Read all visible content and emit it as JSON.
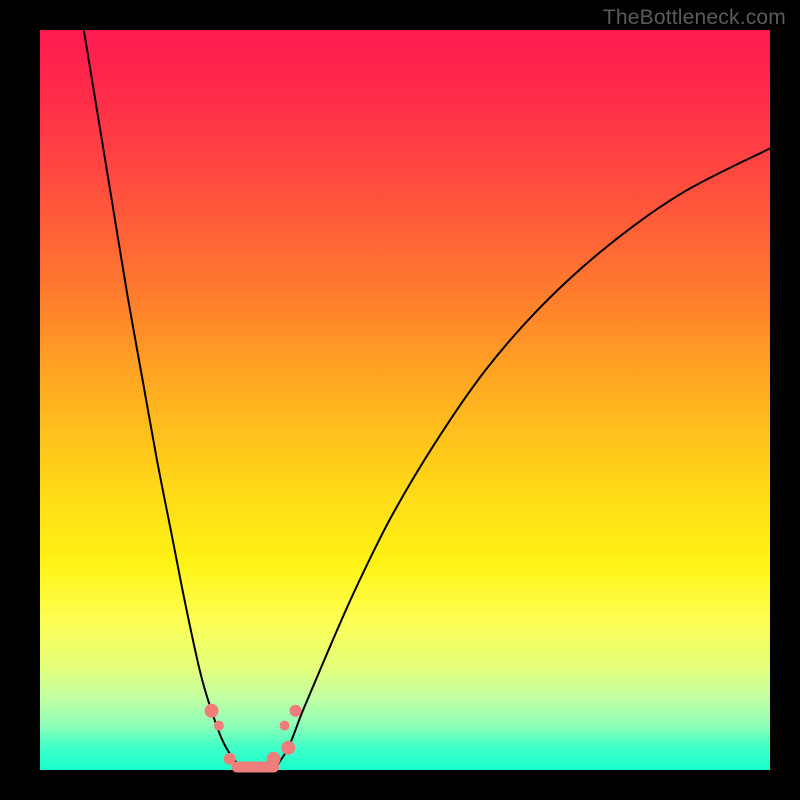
{
  "watermark": "TheBottleneck.com",
  "colors": {
    "frame": "#000000",
    "curve": "#000000",
    "marker": "#ef7d7a",
    "gradient_top": "#ff1a4f",
    "gradient_bottom": "#17ffce"
  },
  "chart_data": {
    "type": "line",
    "title": "",
    "xlabel": "",
    "ylabel": "",
    "xlim": [
      0,
      100
    ],
    "ylim": [
      0,
      100
    ],
    "series": [
      {
        "name": "left-curve",
        "x": [
          6,
          8,
          10,
          12,
          14,
          16,
          18,
          20,
          22,
          23.5,
          25,
          26.5,
          28
        ],
        "y": [
          100,
          88,
          76,
          64,
          53,
          42,
          32,
          22,
          13,
          8,
          4,
          1.5,
          0
        ]
      },
      {
        "name": "right-curve",
        "x": [
          32,
          34,
          36,
          39,
          43,
          48,
          54,
          61,
          69,
          78,
          88,
          100
        ],
        "y": [
          0,
          3,
          8,
          15,
          24,
          34,
          44,
          54,
          63,
          71,
          78,
          84
        ]
      }
    ],
    "markers": [
      {
        "x": 23.5,
        "y": 8,
        "r": 7
      },
      {
        "x": 24.5,
        "y": 6,
        "r": 5
      },
      {
        "x": 26,
        "y": 1.5,
        "r": 6
      },
      {
        "x": 32,
        "y": 1.5,
        "r": 7
      },
      {
        "x": 34,
        "y": 3,
        "r": 7
      },
      {
        "x": 33.5,
        "y": 6,
        "r": 5
      },
      {
        "x": 35,
        "y": 8,
        "r": 6
      }
    ],
    "flat_segment": {
      "x0": 27,
      "x1": 32,
      "y": 0
    }
  }
}
